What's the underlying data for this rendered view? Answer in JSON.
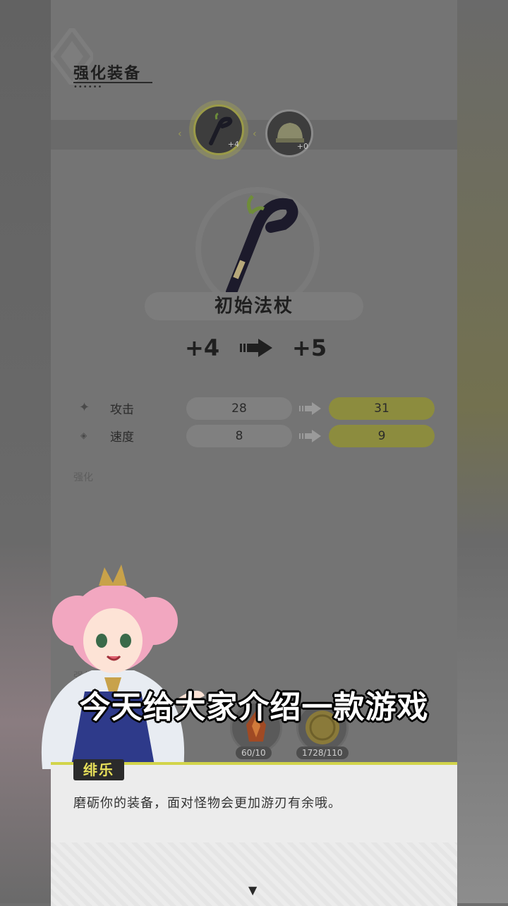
{
  "header": {
    "title": "强化装备"
  },
  "slots": [
    {
      "icon": "staff-icon",
      "level": "+4",
      "active": true
    },
    {
      "icon": "helmet-icon",
      "level": "+0",
      "active": false
    }
  ],
  "item": {
    "name": "初始法杖",
    "level_from": "+4",
    "level_to": "+5"
  },
  "stats": [
    {
      "icon": "sparkle-icon",
      "label": "攻击",
      "current": "28",
      "next": "31"
    },
    {
      "icon": "diamond-icon",
      "label": "速度",
      "current": "8",
      "next": "9"
    }
  ],
  "section_labels": {
    "upgrade": "强化",
    "materials": "强化"
  },
  "materials": [
    {
      "icon": "fire-crystal-icon",
      "count": "60/10"
    },
    {
      "icon": "gold-coin-icon",
      "count": "1728/110"
    }
  ],
  "caption": "今天给大家介绍一款游戏",
  "dialog": {
    "speaker": "绯乐",
    "text": "磨砺你的装备，面对怪物会更加游刃有余哦。",
    "next_icon": "▼"
  },
  "colors": {
    "accent": "#d2d44a",
    "panel": "#747474",
    "dialog": "#ececec"
  }
}
